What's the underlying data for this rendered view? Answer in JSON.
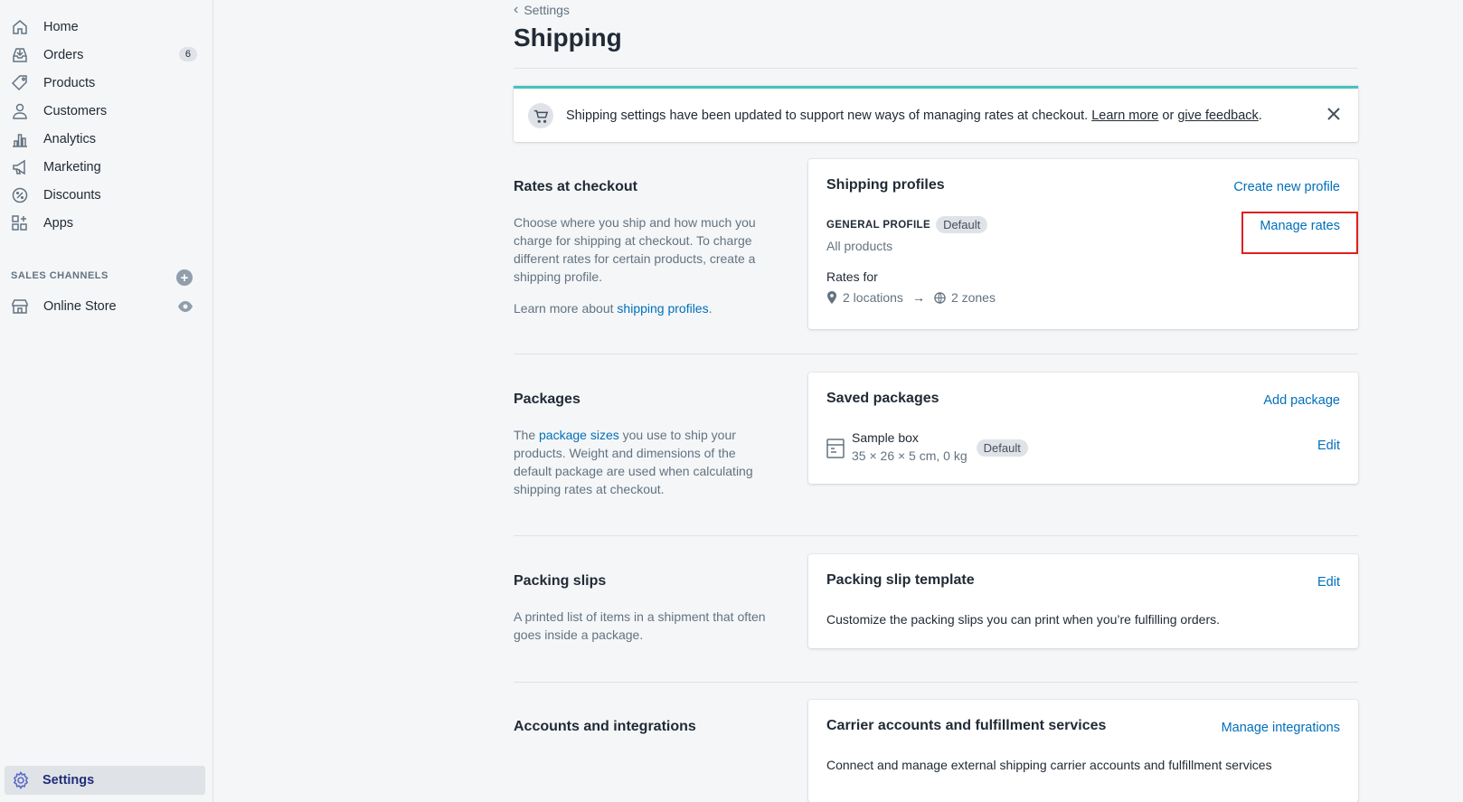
{
  "sidebar": {
    "items": [
      {
        "label": "Home"
      },
      {
        "label": "Orders",
        "badge": "6"
      },
      {
        "label": "Products"
      },
      {
        "label": "Customers"
      },
      {
        "label": "Analytics"
      },
      {
        "label": "Marketing"
      },
      {
        "label": "Discounts"
      },
      {
        "label": "Apps"
      }
    ],
    "sales_channels_label": "SALES CHANNELS",
    "online_store_label": "Online Store",
    "settings_label": "Settings"
  },
  "header": {
    "breadcrumb": "Settings",
    "title": "Shipping"
  },
  "banner": {
    "text": "Shipping settings have been updated to support new ways of managing rates at checkout.",
    "learn_more": "Learn more",
    "or": "or",
    "give_feedback": "give feedback",
    "period": "."
  },
  "rates": {
    "title": "Rates at checkout",
    "desc": "Choose where you ship and how much you charge for shipping at checkout. To charge different rates for certain products, create a shipping profile.",
    "learn_prefix": "Learn more about",
    "learn_link": "shipping profiles",
    "learn_suffix": ".",
    "card": {
      "title": "Shipping profiles",
      "action": "Create new profile",
      "profile_name": "GENERAL PROFILE",
      "profile_badge": "Default",
      "profile_sub": "All products",
      "manage_rates": "Manage rates",
      "rates_for": "Rates for",
      "locations": "2 locations",
      "zones": "2 zones"
    }
  },
  "packages": {
    "title": "Packages",
    "desc_prefix": "The",
    "desc_link": "package sizes",
    "desc_suffix": "you use to ship your products. Weight and dimensions of the default package are used when calculating shipping rates at checkout.",
    "card": {
      "title": "Saved packages",
      "action": "Add package",
      "pkg_name": "Sample box",
      "pkg_dims": "35 × 26 × 5 cm, 0 kg",
      "pkg_badge": "Default",
      "edit": "Edit"
    }
  },
  "slips": {
    "title": "Packing slips",
    "desc": "A printed list of items in a shipment that often goes inside a package.",
    "card": {
      "title": "Packing slip template",
      "action": "Edit",
      "desc": "Customize the packing slips you can print when you’re fulfilling orders."
    }
  },
  "accounts": {
    "title": "Accounts and integrations",
    "card": {
      "title": "Carrier accounts and fulfillment services",
      "action": "Manage integrations",
      "desc": "Connect and manage external shipping carrier accounts and fulfillment services"
    }
  },
  "colors": {
    "link": "#006fbb",
    "highlight": "#e02020",
    "banner_accent": "#47c1bf"
  }
}
